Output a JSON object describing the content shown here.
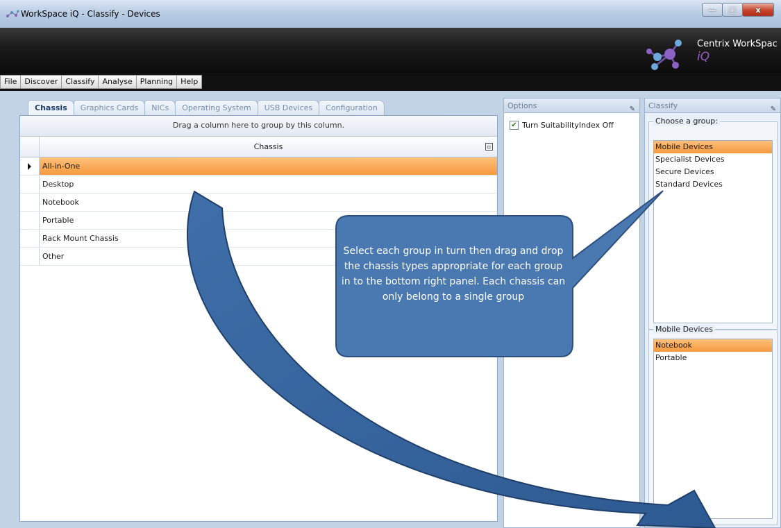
{
  "window": {
    "title": "WorkSpace iQ - Classify - Devices",
    "minimize_glyph": "—",
    "maximize_glyph": "□",
    "close_glyph": "x"
  },
  "banner": {
    "brand": "Centrix WorkSpac",
    "brand_sub": "iQ"
  },
  "menu": [
    "File",
    "Discover",
    "Classify",
    "Analyse",
    "Planning",
    "Help"
  ],
  "tabs": [
    "Chassis",
    "Graphics Cards",
    "NICs",
    "Operating System",
    "USB Devices",
    "Configuration"
  ],
  "active_tab": "Chassis",
  "grid": {
    "group_hint": "Drag a column here to group by this column.",
    "column": "Chassis",
    "rows": [
      "All-in-One",
      "Desktop",
      "Notebook",
      "Portable",
      "Rack Mount Chassis",
      "Other"
    ],
    "selected_row": "All-in-One"
  },
  "options": {
    "title": "Options",
    "checkbox_label": "Turn SuitabilityIndex Off",
    "checked": true
  },
  "classify": {
    "title": "Classify",
    "choose_group_label": "Choose a group:",
    "groups": [
      "Mobile Devices",
      "Specialist Devices",
      "Secure Devices",
      "Standard Devices"
    ],
    "selected_group": "Mobile Devices",
    "members_label": "Mobile Devices",
    "members": [
      "Notebook",
      "Portable"
    ],
    "selected_member": "Notebook"
  },
  "callout": {
    "text": "Select each group in turn then  drag and drop the chassis types appropriate for  each group in to the bottom right panel.  Each chassis can only belong to a single group"
  },
  "colors": {
    "selection": "#f7993e",
    "callout_fill": "#4a78b0",
    "callout_stroke": "#2c4f7d",
    "logo_purple": "#9a5fc7"
  },
  "icons": {
    "app": "network-molecule-icon",
    "pin": "pin-icon",
    "filter": "filter-icon",
    "row_indicator": "current-row-arrow-icon"
  }
}
